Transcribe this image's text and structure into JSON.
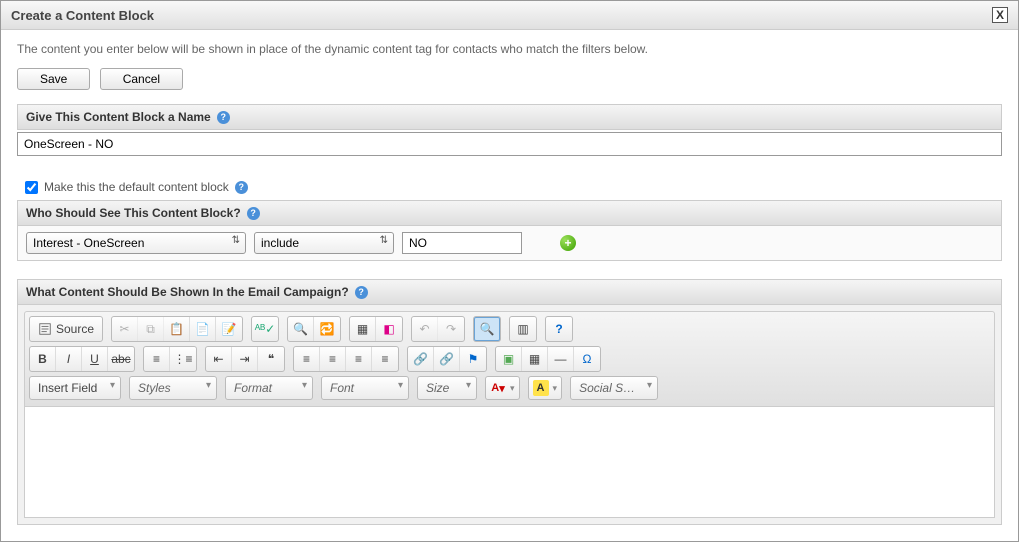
{
  "modal": {
    "title": "Create a Content Block",
    "intro": "The content you enter below will be shown in place of the dynamic content tag for contacts who match the filters below.",
    "save_label": "Save",
    "cancel_label": "Cancel"
  },
  "name_section": {
    "heading": "Give This Content Block a Name",
    "value": "OneScreen - NO"
  },
  "default_section": {
    "checkbox_label": "Make this the default content block",
    "checked": true
  },
  "audience_section": {
    "heading": "Who Should See This Content Block?",
    "field_select": "Interest - OneScreen",
    "op_select": "include",
    "value": "NO"
  },
  "content_section": {
    "heading": "What Content Should Be Shown In the Email Campaign?"
  },
  "toolbar": {
    "source": "Source",
    "combos": {
      "insert_field": "Insert Field",
      "styles": "Styles",
      "format": "Format",
      "font": "Font",
      "size": "Size",
      "social": "Social S…"
    }
  }
}
